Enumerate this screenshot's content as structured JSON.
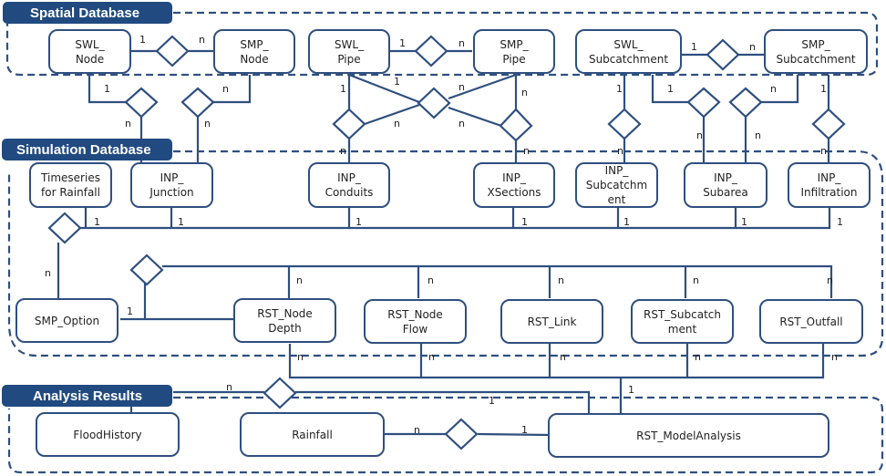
{
  "sections": {
    "spatial": "Spatial Database",
    "simulation": "Simulation Database",
    "analysis": "Analysis Results"
  },
  "entities": {
    "swl_node": "SWL_\nNode",
    "smp_node": "SMP_\nNode",
    "swl_pipe": "SWL_\nPipe",
    "smp_pipe": "SMP_\nPipe",
    "swl_subcatchment": "SWL_\nSubcatchment",
    "smp_subcatchment": "SMP_\nSubcatchment",
    "timeseries_rainfall": "Timeseries\nfor Rainfall",
    "inp_junction": "INP_\nJunction",
    "inp_conduits": "INP_\nConduits",
    "inp_xsections": "INP_\nXSections",
    "inp_subcatchment": "INP_\nSubcatchm\nent",
    "inp_subarea": "INP_\nSubarea",
    "inp_infiltration": "INP_\nInfiltration",
    "smp_option": "SMP_Option",
    "rst_node_depth": "RST_Node\nDepth",
    "rst_node_flow": "RST_Node\nFlow",
    "rst_link": "RST_Link",
    "rst_subcatchment": "RST_Subcatch\nment",
    "rst_outfall": "RST_Outfall",
    "flood_history": "FloodHistory",
    "rainfall": "Rainfall",
    "rst_model_analysis": "RST_ModelAnalysis"
  },
  "cardinality": {
    "one": "1",
    "many": "n"
  }
}
